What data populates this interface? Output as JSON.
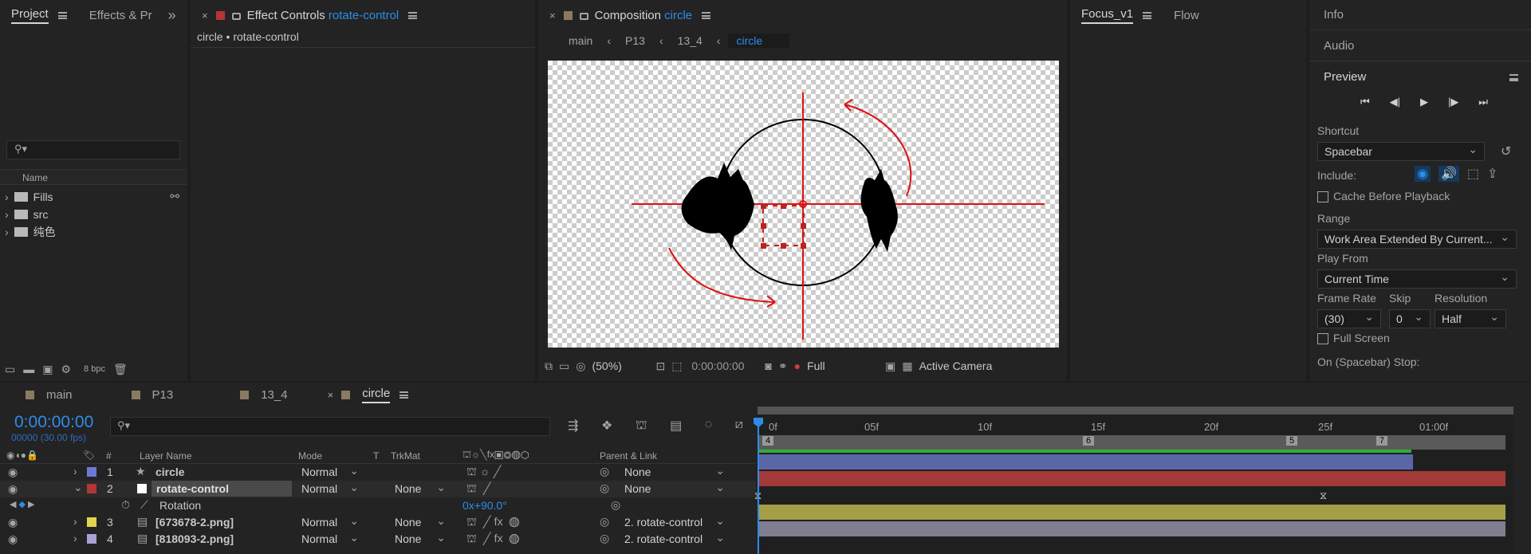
{
  "project_panel": {
    "tabs": [
      "Project",
      "Effects & Pr"
    ],
    "more": "»",
    "search_placeholder": "",
    "col_name": "Name",
    "items": [
      {
        "label": "Fills"
      },
      {
        "label": "src"
      },
      {
        "label": "纯色"
      }
    ],
    "bpc": "8 bpc"
  },
  "effect_controls": {
    "title": "Effect Controls",
    "layer": "rotate-control",
    "sub": "circle • rotate-control"
  },
  "composition": {
    "title": "Composition",
    "name": "circle",
    "breadcrumbs": [
      "main",
      "P13",
      "13_4",
      "circle"
    ],
    "zoom": "(50%)",
    "time": "0:00:00:00",
    "resolution": "Full",
    "camera": "Active Camera"
  },
  "focus_panel": {
    "tabs": [
      "Focus_v1",
      "Flow"
    ]
  },
  "right_panel": {
    "info": "Info",
    "audio": "Audio",
    "preview": "Preview",
    "shortcut_label": "Shortcut",
    "shortcut_value": "Spacebar",
    "include_label": "Include:",
    "cache_label": "Cache Before Playback",
    "range_label": "Range",
    "range_value": "Work Area Extended By Current...",
    "play_from_label": "Play From",
    "play_from_value": "Current Time",
    "frame_rate_label": "Frame Rate",
    "skip_label": "Skip",
    "resolution_label": "Resolution",
    "frame_rate_value": "(30)",
    "skip_value": "0",
    "resolution_value": "Half",
    "full_screen_label": "Full Screen",
    "stop_label": "On (Spacebar) Stop:"
  },
  "timeline": {
    "tabs": [
      "main",
      "P13",
      "13_4",
      "circle"
    ],
    "timecode": "0:00:00:00",
    "frame_info": "00000 (30.00 fps)",
    "col_hash": "#",
    "col_layer": "Layer Name",
    "col_mode": "Mode",
    "col_t": "T",
    "col_trkmat": "TrkMat",
    "col_parent": "Parent & Link",
    "ruler": [
      "0f",
      "05f",
      "10f",
      "15f",
      "20f",
      "25f",
      "01:00f"
    ],
    "markers": [
      "4",
      "6",
      "5",
      "7"
    ],
    "layers": [
      {
        "num": "1",
        "name": "circle",
        "mode": "Normal",
        "trkmat": "",
        "parent": "None",
        "color": "#6b78d6"
      },
      {
        "num": "2",
        "name": "rotate-control",
        "mode": "Normal",
        "trkmat": "None",
        "parent": "None",
        "color": "#b53434"
      },
      {
        "num": "3",
        "name": "[673678-2.png]",
        "mode": "Normal",
        "trkmat": "None",
        "parent": "2. rotate-control",
        "color": "#e3d44b"
      },
      {
        "num": "4",
        "name": "[818093-2.png]",
        "mode": "Normal",
        "trkmat": "None",
        "parent": "2. rotate-control",
        "color": "#a7a2d6"
      }
    ],
    "prop_name": "Rotation",
    "prop_value": "0x+90.0°"
  }
}
